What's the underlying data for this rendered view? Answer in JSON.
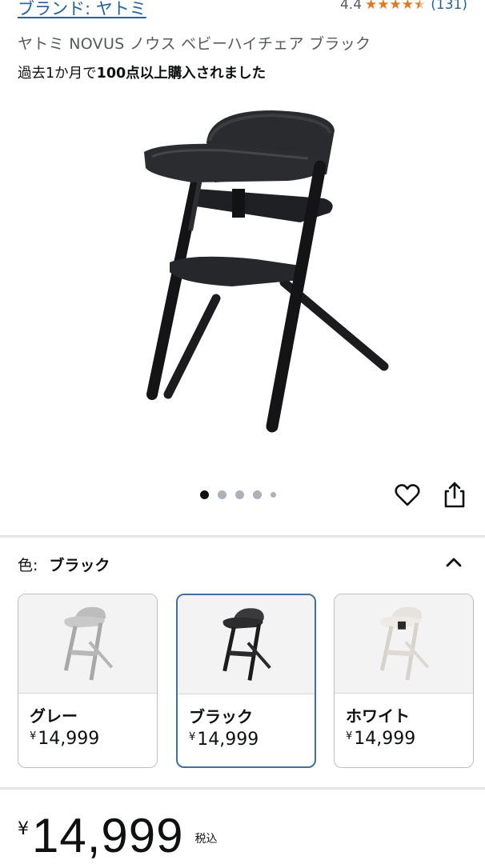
{
  "header": {
    "brand_link": "ブランド: ヤトミ",
    "rating_value": "4.4",
    "rating_count": "(131)",
    "rating_stars": 4.4,
    "star_color": "#de7921"
  },
  "product": {
    "title": "ヤトミ NOVUS ノウス ベビーハイチェア ブラック",
    "bought_prefix": "過去1か月で",
    "bought_bold": "100点以上購入されました"
  },
  "gallery": {
    "image_count": 5,
    "active_index": 0,
    "icons": [
      "heart-icon",
      "share-icon"
    ]
  },
  "variation": {
    "label": "色:",
    "selected": "ブラック",
    "icon": "chevron-up-icon",
    "options": [
      {
        "name": "グレー",
        "yen": "¥",
        "price": "14,999",
        "color": "#9a9a9a"
      },
      {
        "name": "ブラック",
        "yen": "¥",
        "price": "14,999",
        "color": "#2a2a2a"
      },
      {
        "name": "ホワイト",
        "yen": "¥",
        "price": "14,999",
        "color": "#e4e1dc"
      }
    ]
  },
  "price": {
    "yen": "¥",
    "amount": "14,999",
    "tax_note": "税込"
  },
  "colors": {
    "link": "#2162a1",
    "selected_border": "#3f6ea1"
  }
}
